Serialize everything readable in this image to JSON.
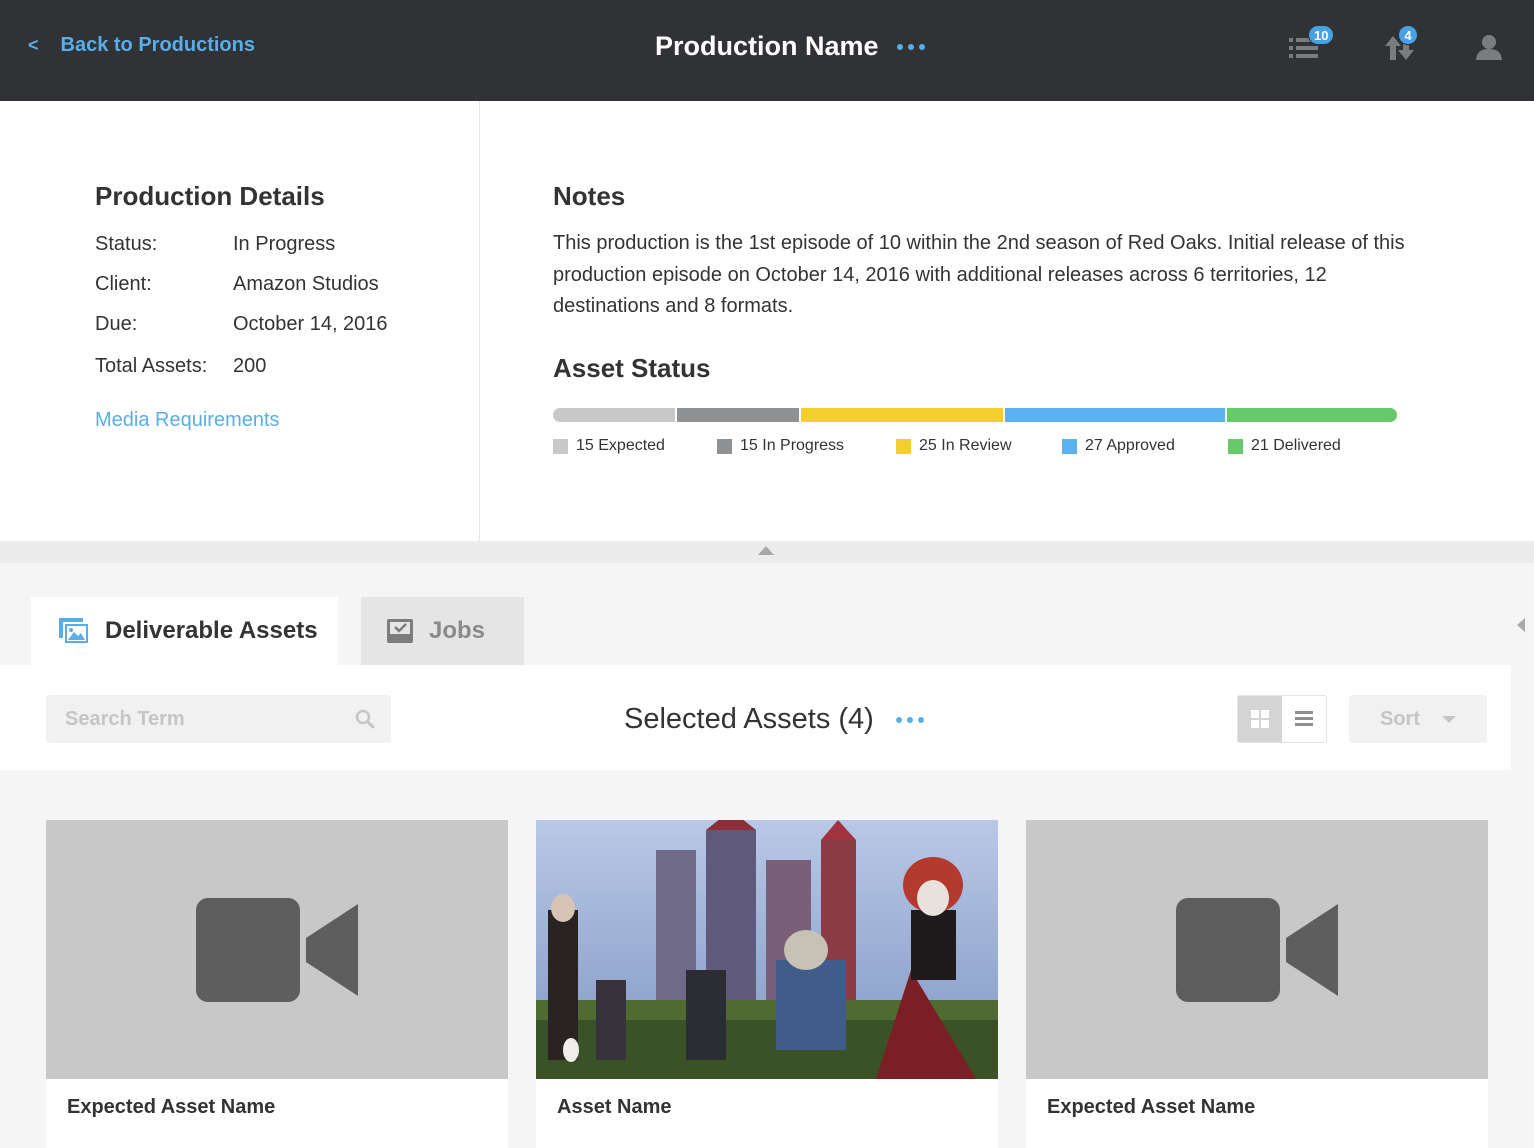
{
  "header": {
    "back_label": "Back to Productions",
    "back_chevron": "<",
    "title": "Production Name",
    "queue_badge": "10",
    "transfer_badge": "4",
    "icons": [
      "queue-list-icon",
      "transfer-arrows-icon",
      "user-avatar-icon"
    ]
  },
  "details": {
    "heading": "Production Details",
    "rows": [
      {
        "label": "Status:",
        "value": "In Progress"
      },
      {
        "label": "Client:",
        "value": "Amazon Studios"
      },
      {
        "label": "Due:",
        "value": "October 14, 2016"
      },
      {
        "label": "Total Assets:",
        "value": "200"
      }
    ],
    "media_link": "Media Requirements"
  },
  "notes": {
    "heading": "Notes",
    "text": "This production is the 1st episode of 10 within the 2nd season of Red Oaks. Initial release of this production episode on October 14, 2016 with additional releases across 6 territories, 12 destinations and 8 formats."
  },
  "asset_status": {
    "heading": "Asset Status",
    "segments": [
      {
        "label": "15 Expected",
        "count": 15,
        "color": "#c8c8c8"
      },
      {
        "label": "15 In Progress",
        "count": 15,
        "color": "#909193"
      },
      {
        "label": "25 In Review",
        "count": 25,
        "color": "#f3cf2c"
      },
      {
        "label": "27 Approved",
        "count": 27,
        "color": "#5ab3ee"
      },
      {
        "label": "21 Delivered",
        "count": 21,
        "color": "#66c96b"
      }
    ]
  },
  "tabs": [
    {
      "label": "Deliverable Assets",
      "icon": "images-icon",
      "active": true
    },
    {
      "label": "Jobs",
      "icon": "inbox-tray-icon",
      "active": false
    }
  ],
  "toolbar": {
    "search_placeholder": "Search Term",
    "selected_title": "Selected Assets (4)",
    "sort_label": "Sort",
    "view_mode": "grid"
  },
  "assets": [
    {
      "name": "Expected Asset Name",
      "thumb": "video-placeholder"
    },
    {
      "name": "Asset Name",
      "thumb": "image"
    },
    {
      "name": "Expected Asset Name",
      "thumb": "video-placeholder"
    }
  ],
  "colors": {
    "accent": "#5aaee8",
    "topbar": "#303236",
    "badge": "#45a3e5"
  }
}
